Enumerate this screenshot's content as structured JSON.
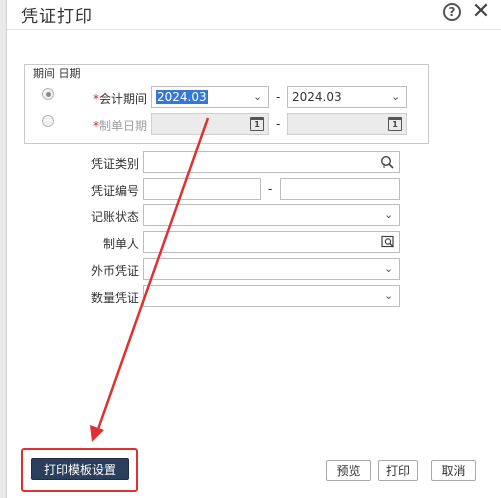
{
  "dialog": {
    "title": "凭证打印",
    "help_icon": "?",
    "close_icon": "✕"
  },
  "period": {
    "legend": "期间 日期",
    "accounting_period": {
      "label_star": "*",
      "label": "会计期间",
      "from": "2024.03",
      "to": "2024.03",
      "selected": true
    },
    "voucher_date": {
      "label_star": "*",
      "label": "制单日期",
      "selected": false
    },
    "dash": "-"
  },
  "form": {
    "voucher_type": {
      "label": "凭证类别"
    },
    "voucher_no": {
      "label": "凭证编号",
      "dash": "-"
    },
    "posting_status": {
      "label": "记账状态"
    },
    "creator": {
      "label": "制单人"
    },
    "foreign_currency": {
      "label": "外币凭证"
    },
    "quantity": {
      "label": "数量凭证"
    }
  },
  "buttons": {
    "print_template": "打印模板设置",
    "preview": "预览",
    "print": "打印",
    "cancel": "取消"
  },
  "colors": {
    "annotation": "#e03030",
    "primary_button": "#2b3e5c",
    "selection": "#3478d4"
  }
}
